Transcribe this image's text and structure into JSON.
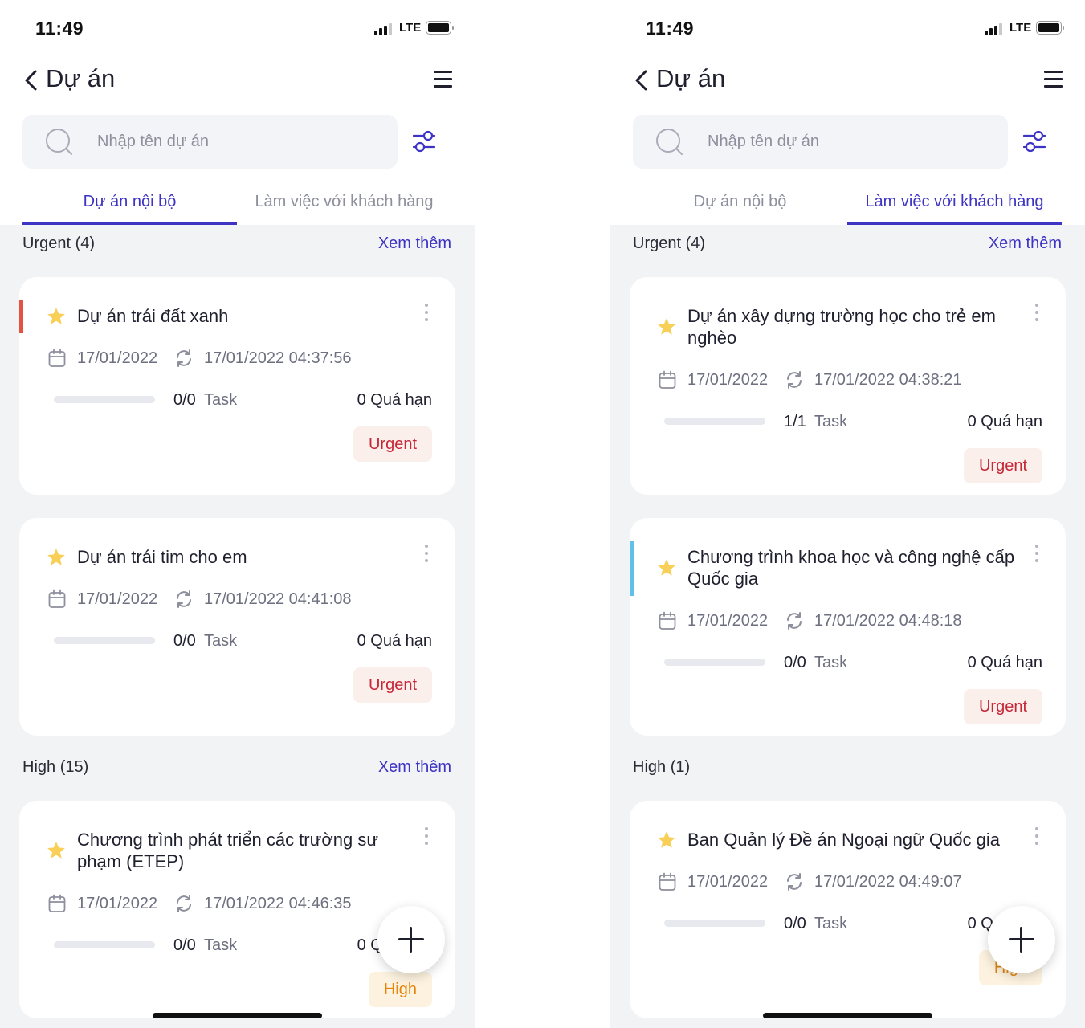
{
  "screens": [
    {
      "status": {
        "time": "11:49",
        "network": "LTE"
      },
      "header": {
        "title": "Dự án"
      },
      "search": {
        "placeholder": "Nhập tên dự án"
      },
      "tabs": [
        {
          "label": "Dự án nội bộ",
          "active": true
        },
        {
          "label": "Làm việc với khách hàng",
          "active": false
        }
      ],
      "sections": [
        {
          "title": "Urgent (4)",
          "see_more": "Xem thêm",
          "cards": [
            {
              "title": "Dự án trái đất xanh",
              "date": "17/01/2022",
              "updated": "17/01/2022 04:37:56",
              "tasks": "0/0",
              "task_label": "Task",
              "progress": 0,
              "overdue": "0 Quá hạn",
              "priority": "Urgent",
              "accent_color": "#e4533f"
            },
            {
              "title": "Dự án trái tim cho em",
              "date": "17/01/2022",
              "updated": "17/01/2022 04:41:08",
              "tasks": "0/0",
              "task_label": "Task",
              "progress": 0,
              "overdue": "0 Quá hạn",
              "priority": "Urgent"
            }
          ]
        },
        {
          "title": "High (15)",
          "see_more": "Xem thêm",
          "cards": [
            {
              "title": "Chương trình phát triển các trường sư phạm (ETEP)",
              "date": "17/01/2022",
              "updated": "17/01/2022 04:46:35",
              "tasks": "0/0",
              "task_label": "Task",
              "progress": 0,
              "overdue": "0 Quá hạn",
              "priority": "High"
            }
          ]
        }
      ]
    },
    {
      "status": {
        "time": "11:49",
        "network": "LTE"
      },
      "header": {
        "title": "Dự án"
      },
      "search": {
        "placeholder": "Nhập tên dự án"
      },
      "tabs": [
        {
          "label": "Dự án nội bộ",
          "active": false
        },
        {
          "label": "Làm việc với khách hàng",
          "active": true
        }
      ],
      "sections": [
        {
          "title": "Urgent (4)",
          "see_more": "Xem thêm",
          "cards": [
            {
              "title": "Dự án xây dựng trường học cho trẻ em nghèo",
              "date": "17/01/2022",
              "updated": "17/01/2022 04:38:21",
              "tasks": "1/1",
              "task_label": "Task",
              "progress": 0,
              "overdue": "0 Quá hạn",
              "priority": "Urgent"
            },
            {
              "title": "Chương trình khoa học và công nghệ cấp Quốc gia",
              "date": "17/01/2022",
              "updated": "17/01/2022 04:48:18",
              "tasks": "0/0",
              "task_label": "Task",
              "progress": 0,
              "overdue": "0 Quá hạn",
              "priority": "Urgent",
              "accent_color": "#62bfea"
            }
          ]
        },
        {
          "title": "High (1)",
          "cards": [
            {
              "title": "Ban Quản lý Đề án Ngoại ngữ Quốc gia",
              "date": "17/01/2022",
              "updated": "17/01/2022 04:49:07",
              "tasks": "0/0",
              "task_label": "Task",
              "progress": 0,
              "overdue": "0 Quá hạn",
              "priority": "High"
            }
          ]
        }
      ]
    }
  ],
  "colors": {
    "accent": "#3d33c4",
    "urgent_text": "#c62838",
    "high_text": "#e3860a",
    "star": "#f9d057"
  },
  "icons": [
    "back-icon",
    "menu-icon",
    "search-icon",
    "filter-icon",
    "star-icon",
    "calendar-icon",
    "sync-icon",
    "more-icon",
    "add-icon"
  ]
}
